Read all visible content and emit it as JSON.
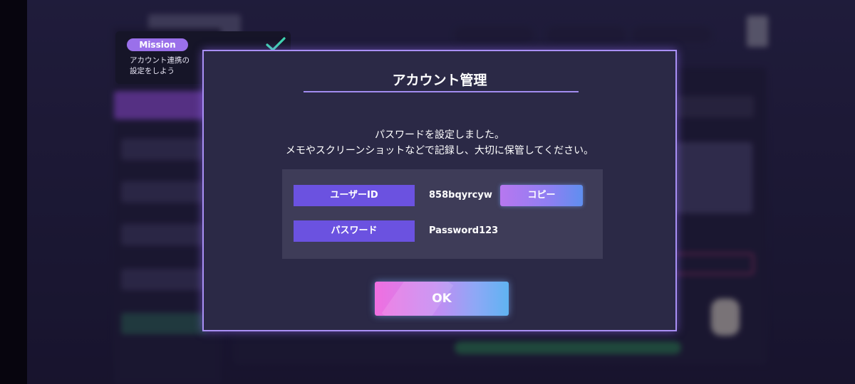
{
  "mission": {
    "badge": "Mission",
    "line1": "アカウント連携の",
    "line2": "設定をしよう",
    "status_icon": "checkmark-icon",
    "check_color": "#3fd6b0"
  },
  "dialog": {
    "title": "アカウント管理",
    "message_line1": "パスワードを設定しました。",
    "message_line2": "メモやスクリーンショットなどで記録し、大切に保管してください。",
    "user_id_label": "ユーザーID",
    "user_id_value": "858bqyrcyw",
    "copy_label": "コピー",
    "password_label": "パスワード",
    "password_value": "Password123",
    "ok_label": "OK"
  },
  "colors": {
    "accent": "#6b52e0",
    "dialog_border": "#a98ff5",
    "ok_gradient_start": "#f06fe0",
    "ok_gradient_end": "#5fb3f2"
  }
}
